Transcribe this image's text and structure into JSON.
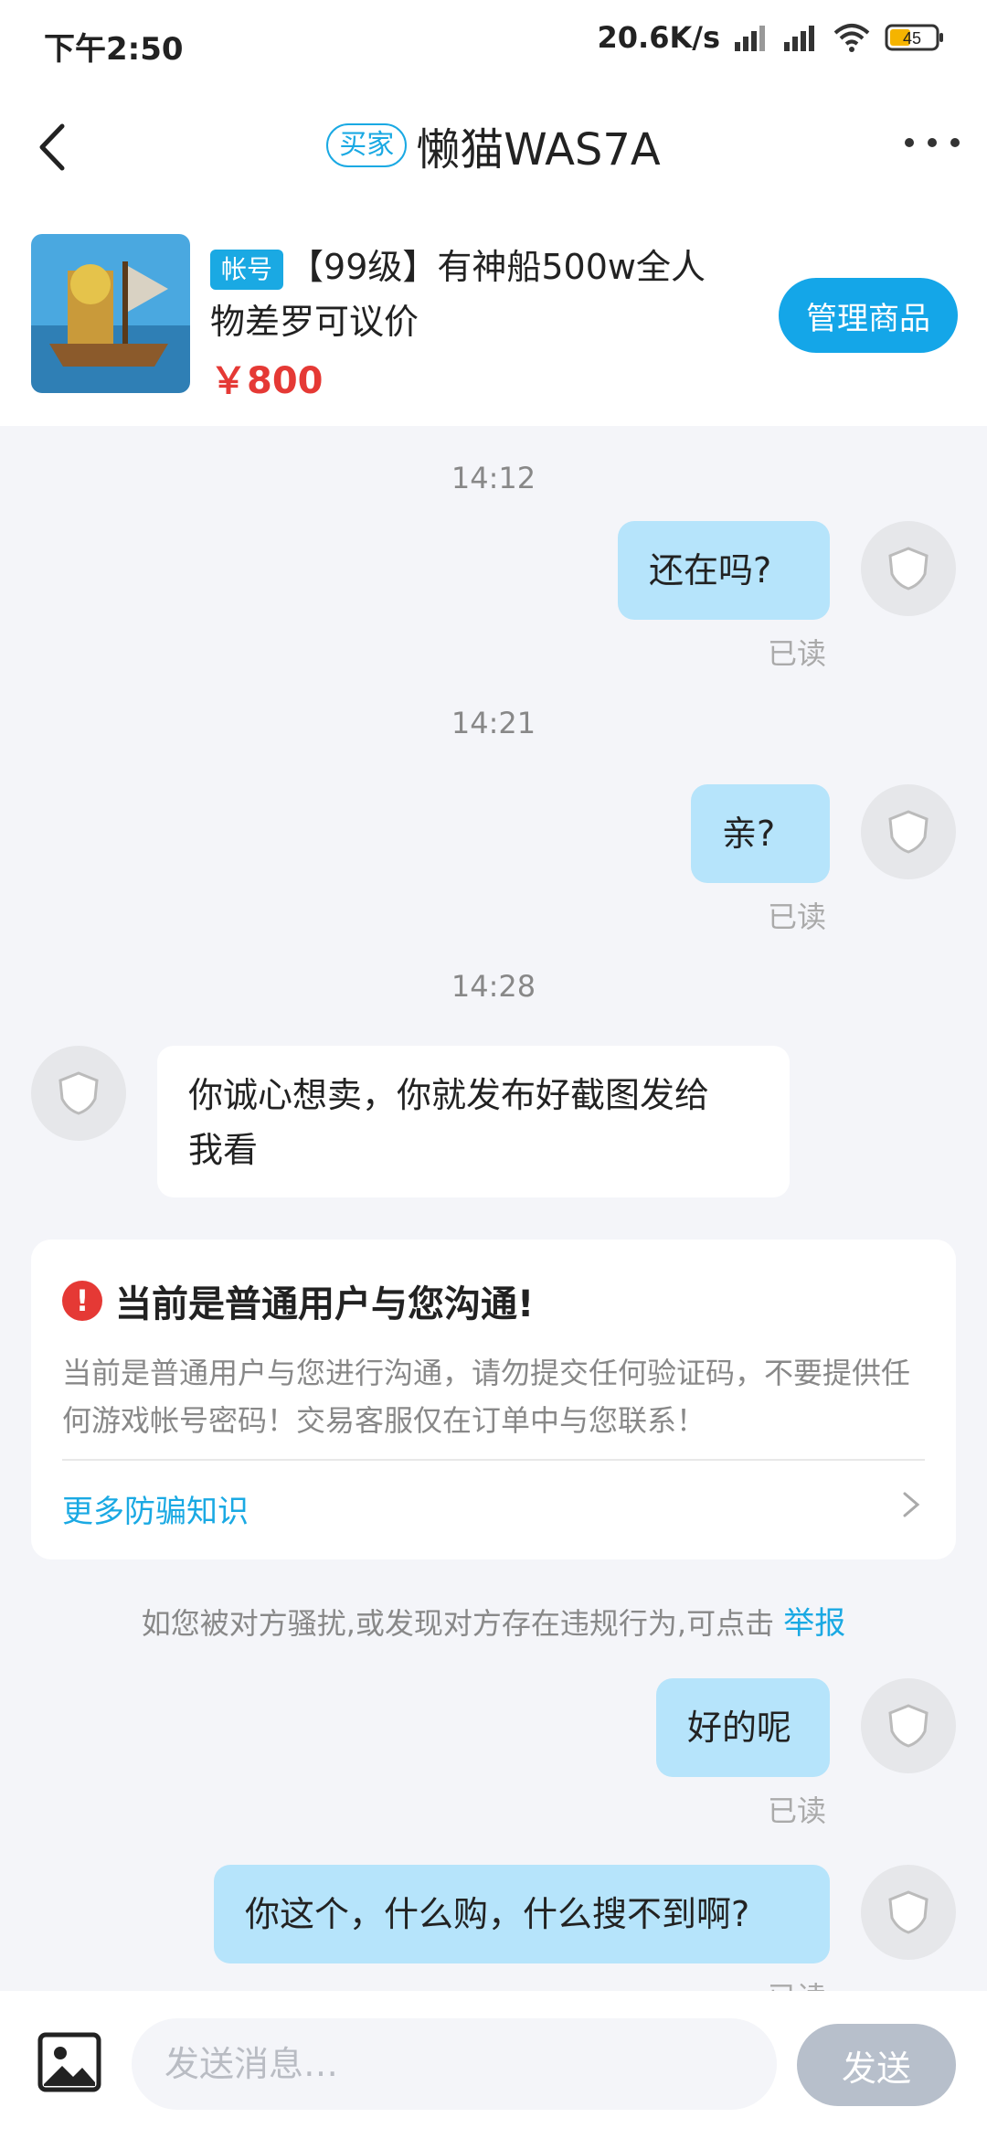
{
  "status_bar": {
    "time": "下午2:50",
    "net_speed": "20.6K/s",
    "battery": "45"
  },
  "header": {
    "role_badge": "买家",
    "title": "懒猫WAS7A"
  },
  "product": {
    "type_badge": "帐号",
    "title_line1": "【99级】有神船500w全人",
    "title_line2": "物差罗可议价",
    "price": "￥800",
    "manage_label": "管理商品"
  },
  "messages": [
    {
      "time": "14:12",
      "text": "还在吗?",
      "read": "已读"
    },
    {
      "time": "14:21",
      "text": "亲?",
      "read": "已读"
    },
    {
      "time": "14:28",
      "text_line1": "你诚心想卖，你就发布好截图发给",
      "text_line2": "我看"
    },
    {
      "text": "好的呢",
      "read": "已读"
    },
    {
      "text": "你这个，什么购，什么搜不到啊?",
      "read": "已读"
    }
  ],
  "notice": {
    "title": "当前是普通用户与您沟通!",
    "body": "当前是普通用户与您进行沟通，请勿提交任何验证码，不要提供任何游戏帐号密码！交易客服仅在订单中与您联系！",
    "link": "更多防骗知识"
  },
  "report": {
    "text": "如您被对方骚扰,或发现对方存在违规行为,可点击 ",
    "link": "举报"
  },
  "input_bar": {
    "placeholder": "发送消息…",
    "send_label": "发送"
  },
  "colors": {
    "accent": "#1aa9e3",
    "my_bubble": "#b6e4fb",
    "price": "#e53935",
    "send_disabled": "#b7bfcb"
  }
}
